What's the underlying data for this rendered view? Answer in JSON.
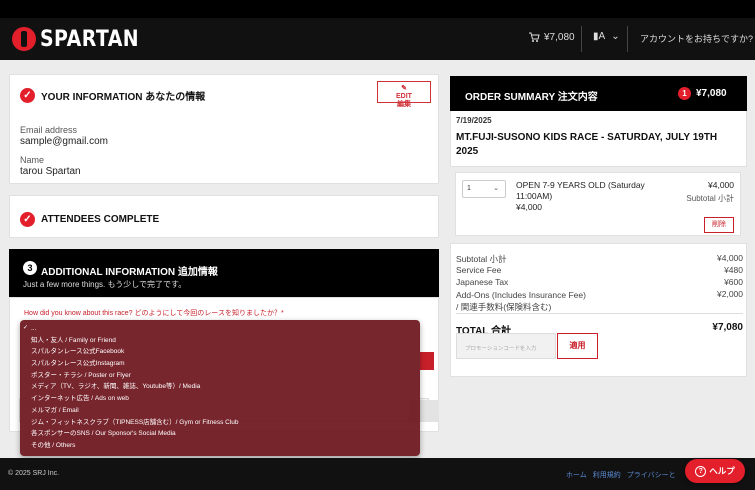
{
  "header": {
    "brand": "SPARTAN",
    "cart_total": "¥7,080",
    "lang_label": "▮A",
    "account_link": "アカウントをお持ちですか?"
  },
  "your_info": {
    "title": "YOUR INFORMATION あなたの情報",
    "edit_label": "EDIT",
    "edit_label_ja": "編集",
    "email_label": "Email address",
    "email_value": "sample@gmail.com",
    "name_label": "Name",
    "name_value": "tarou Spartan"
  },
  "attendees": {
    "title": "ATTENDEES COMPLETE"
  },
  "additional": {
    "number": "3",
    "title": "ADDITIONAL INFORMATION 追加情報",
    "subtitle": "Just a few more things.  もう少しで完了です。",
    "question": "How did you know about this race? どのようにして今回のレースを知りましたか？*"
  },
  "dropdown": {
    "options": [
      "...",
      "知人・友人 / Family or Friend",
      "スパルタンレース公式Facebook",
      "スパルタンレース公式Instagram",
      "ポスター・チラシ / Poster or Flyer",
      "メディア（TV、ラジオ、新聞、雑誌、Youtube等）/ Media",
      "インターネット広告 / Ads on web",
      "メルマガ / Email",
      "ジム・フィットネスクラブ（TIPNESS店舗含む）/ Gym or Fitness Club",
      "各スポンサーのSNS / Our Sponsor's Social Media",
      "その他 / Others"
    ],
    "selected_index": 0
  },
  "order": {
    "title": "ORDER SUMMARY  注文内容",
    "badge_count": "1",
    "total_top": "¥7,080",
    "race_date": "7/19/2025",
    "race_name": "MT.FUJI-SUSONO KIDS RACE - SATURDAY, JULY 19TH 2025",
    "item": {
      "qty": "1",
      "description": "OPEN 7-9 YEARS OLD (Saturday 11:00AM)",
      "unit_price": "¥4,000",
      "price": "¥4,000",
      "subtotal_label": "Subtotal  小計",
      "delete_label": "削除"
    },
    "summary": {
      "subtotal_label": "Subtotal  小計",
      "subtotal": "¥4,000",
      "service_fee_label": "Service Fee",
      "service_fee": "¥480",
      "tax_label": "Japanese Tax",
      "tax": "¥600",
      "addons_label": "Add-Ons (Includes Insurance Fee) / 関連手数料(保険料含む)",
      "addons": "¥2,000",
      "total_label": "TOTAL  合計",
      "total": "¥7,080",
      "promo_placeholder": "プロモーションコードを入力",
      "apply_label": "適用"
    }
  },
  "footer": {
    "copyright": "© 2025 SRJ Inc.",
    "links": [
      "ホーム",
      "利用規約",
      "プライバシーと"
    ],
    "help_label": "ヘルプ"
  },
  "colors": {
    "accent": "#e21f2b",
    "header_bg": "#111111",
    "link": "#5a8bd6"
  }
}
